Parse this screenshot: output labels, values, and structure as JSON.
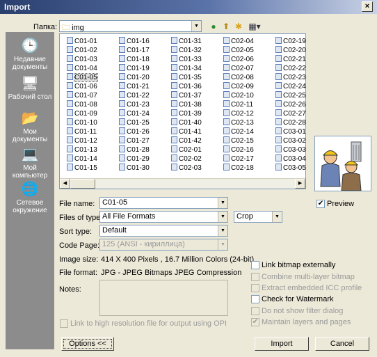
{
  "window": {
    "title": "Import",
    "close": "×"
  },
  "lookin": {
    "label": "Папка:",
    "folder": "img"
  },
  "places": [
    {
      "label": "Недавние документы",
      "icon": "recent-documents-icon",
      "glyph": "🕒"
    },
    {
      "label": "Рабочий стол",
      "icon": "desktop-icon",
      "glyph": "🖥"
    },
    {
      "label": "Мои документы",
      "icon": "my-documents-icon",
      "glyph": "📂"
    },
    {
      "label": "Мой компьютер",
      "icon": "my-computer-icon",
      "glyph": "💻"
    },
    {
      "label": "Сетевое окружение",
      "icon": "network-icon",
      "glyph": "🌐"
    }
  ],
  "files": {
    "selected": "C01-05",
    "columns": [
      [
        "C01-01",
        "C01-02",
        "C01-03",
        "C01-04",
        "C01-05",
        "C01-06",
        "C01-07",
        "C01-08",
        "C01-09",
        "C01-10",
        "C01-11",
        "C01-12",
        "C01-13",
        "C01-14",
        "C01-15"
      ],
      [
        "C01-16",
        "C01-17",
        "C01-18",
        "C01-19",
        "C01-20",
        "C01-21",
        "C01-22",
        "C01-23",
        "C01-24",
        "C01-25",
        "C01-26",
        "C01-27",
        "C01-28",
        "C01-29",
        "C01-30"
      ],
      [
        "C01-31",
        "C01-32",
        "C01-33",
        "C01-34",
        "C01-35",
        "C01-36",
        "C01-37",
        "C01-38",
        "C01-39",
        "C01-40",
        "C01-41",
        "C01-42",
        "C02-01",
        "C02-02",
        "C02-03"
      ],
      [
        "C02-04",
        "C02-05",
        "C02-06",
        "C02-07",
        "C02-08",
        "C02-09",
        "C02-10",
        "C02-11",
        "C02-12",
        "C02-13",
        "C02-14",
        "C02-15",
        "C02-16",
        "C02-17",
        "C02-18"
      ],
      [
        "C02-19",
        "C02-20",
        "C02-21",
        "C02-22",
        "C02-23",
        "C02-24",
        "C02-25",
        "C02-26",
        "C02-27",
        "C02-28",
        "C03-01",
        "C03-02",
        "C03-03",
        "C03-04",
        "C03-05"
      ]
    ]
  },
  "form": {
    "filename_label": "File name:",
    "filename_value": "C01-05",
    "filetype_label": "Files of type:",
    "filetype_value": "All File Formats",
    "crop_value": "Crop",
    "sorttype_label": "Sort type:",
    "sorttype_value": "Default",
    "codepage_label": "Code Page:",
    "codepage_value": "125  (ANSI - кириллица)",
    "imagesize_label": "Image size:",
    "imagesize_value": "414 X 400 Pixels , 16.7 Million Colors (24-bit)",
    "fileformat_label": "File format:",
    "fileformat_value": "JPG - JPEG Bitmaps JPEG Compression",
    "notes_label": "Notes:",
    "highres_label": "Link to high resolution file for output using OPI"
  },
  "options": [
    {
      "label": "Link bitmap externally",
      "checked": false,
      "disabled": false
    },
    {
      "label": "Combine multi-layer bitmap",
      "checked": false,
      "disabled": true
    },
    {
      "label": "Extract embedded ICC profile",
      "checked": false,
      "disabled": true
    },
    {
      "label": "Check for Watermark",
      "checked": false,
      "disabled": false
    },
    {
      "label": "Do not show filter dialog",
      "checked": false,
      "disabled": true
    },
    {
      "label": "Maintain layers and pages",
      "checked": true,
      "disabled": true
    }
  ],
  "preview": {
    "label": "Preview",
    "checked": true
  },
  "buttons": {
    "options": "Options <<",
    "import": "Import",
    "cancel": "Cancel"
  },
  "colors": {
    "title_bar": "#2a3f6e",
    "places_bg": "#8c8c8c",
    "face": "#ece9d8",
    "border": "#7f9db9"
  }
}
